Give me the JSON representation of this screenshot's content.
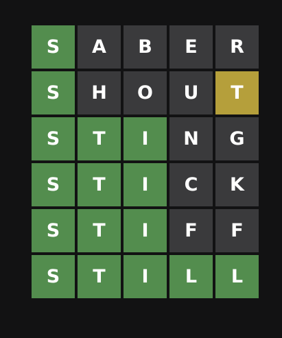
{
  "board": {
    "rows": [
      [
        {
          "letter": "S",
          "state": "correct"
        },
        {
          "letter": "A",
          "state": "absent"
        },
        {
          "letter": "B",
          "state": "absent"
        },
        {
          "letter": "E",
          "state": "absent"
        },
        {
          "letter": "R",
          "state": "absent"
        }
      ],
      [
        {
          "letter": "S",
          "state": "correct"
        },
        {
          "letter": "H",
          "state": "absent"
        },
        {
          "letter": "O",
          "state": "absent"
        },
        {
          "letter": "U",
          "state": "absent"
        },
        {
          "letter": "T",
          "state": "present"
        }
      ],
      [
        {
          "letter": "S",
          "state": "correct"
        },
        {
          "letter": "T",
          "state": "correct"
        },
        {
          "letter": "I",
          "state": "correct"
        },
        {
          "letter": "N",
          "state": "absent"
        },
        {
          "letter": "G",
          "state": "absent"
        }
      ],
      [
        {
          "letter": "S",
          "state": "correct"
        },
        {
          "letter": "T",
          "state": "correct"
        },
        {
          "letter": "I",
          "state": "correct"
        },
        {
          "letter": "C",
          "state": "absent"
        },
        {
          "letter": "K",
          "state": "absent"
        }
      ],
      [
        {
          "letter": "S",
          "state": "correct"
        },
        {
          "letter": "T",
          "state": "correct"
        },
        {
          "letter": "I",
          "state": "correct"
        },
        {
          "letter": "F",
          "state": "absent"
        },
        {
          "letter": "F",
          "state": "absent"
        }
      ],
      [
        {
          "letter": "S",
          "state": "correct"
        },
        {
          "letter": "T",
          "state": "correct"
        },
        {
          "letter": "I",
          "state": "correct"
        },
        {
          "letter": "L",
          "state": "correct"
        },
        {
          "letter": "L",
          "state": "correct"
        }
      ]
    ]
  },
  "colors": {
    "background": "#121213",
    "correct": "#538d4e",
    "present": "#b59f3b",
    "absent": "#3a3a3c",
    "letter": "#ffffff"
  }
}
